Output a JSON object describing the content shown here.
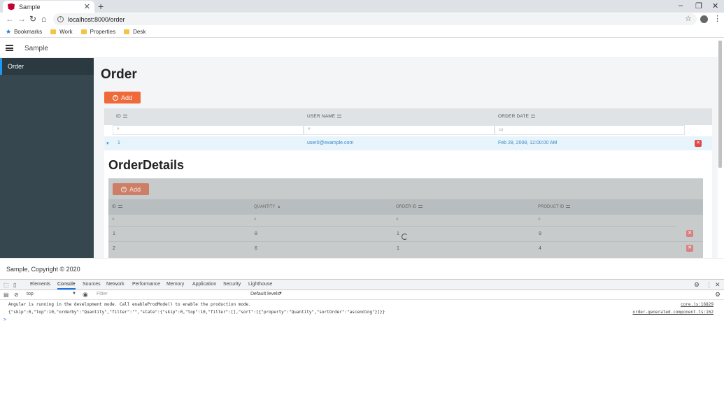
{
  "browser": {
    "tab_title": "Sample",
    "tab_close": "✕",
    "new_tab": "+",
    "window_controls": [
      "–",
      "❐",
      "✕"
    ],
    "url": "localhost:8000/order",
    "bookmarks": [
      "Bookmarks",
      "Work",
      "Properties",
      "Desk"
    ]
  },
  "app": {
    "title": "Sample",
    "sidebar": {
      "items": [
        {
          "label": "Order"
        }
      ]
    },
    "page_title": "Order",
    "add_label": "Add",
    "grid": {
      "columns": [
        "ID",
        "USER NAME",
        "ORDER DATE"
      ],
      "rows": [
        {
          "id": "1",
          "user_name": "user0@example.com",
          "order_date": "Feb 28, 2008, 12:00:00 AM"
        }
      ]
    },
    "details": {
      "title": "OrderDetails",
      "add_label": "Add",
      "columns": [
        "ID",
        "QUANTITY",
        "ORDER ID",
        "PRODUCT ID"
      ],
      "rows": [
        {
          "id": "1",
          "quantity": "8",
          "order_id": "1",
          "product_id": "9"
        },
        {
          "id": "2",
          "quantity": "6",
          "order_id": "1",
          "product_id": "4"
        }
      ]
    },
    "footer": "Sample, Copyright © 2020"
  },
  "devtools": {
    "tabs": [
      "Elements",
      "Console",
      "Sources",
      "Network",
      "Performance",
      "Memory",
      "Application",
      "Security",
      "Lighthouse"
    ],
    "active_tab": "Console",
    "context": "top",
    "filter_placeholder": "Filter",
    "levels": "Default levels",
    "messages": [
      {
        "text": "Angular is running in the development mode. Call enableProdMode() to enable the production mode.",
        "source": "core.js:16829"
      },
      {
        "text": "{\"skip\":0,\"top\":10,\"orderby\":\"Quantity\",\"filter\":\"\",\"state\":{\"skip\":0,\"top\":10,\"filter\":[],\"sort\":[{\"property\":\"Quantity\",\"sortOrder\":\"ascending\"}]}}",
        "source": "order-generated.component.ts:162"
      }
    ],
    "prompt": ">"
  },
  "colors": {
    "accent": "#ef6a3a",
    "sidebar": "#37474f",
    "link": "#3b87c4",
    "delete": "#e04a4a"
  }
}
